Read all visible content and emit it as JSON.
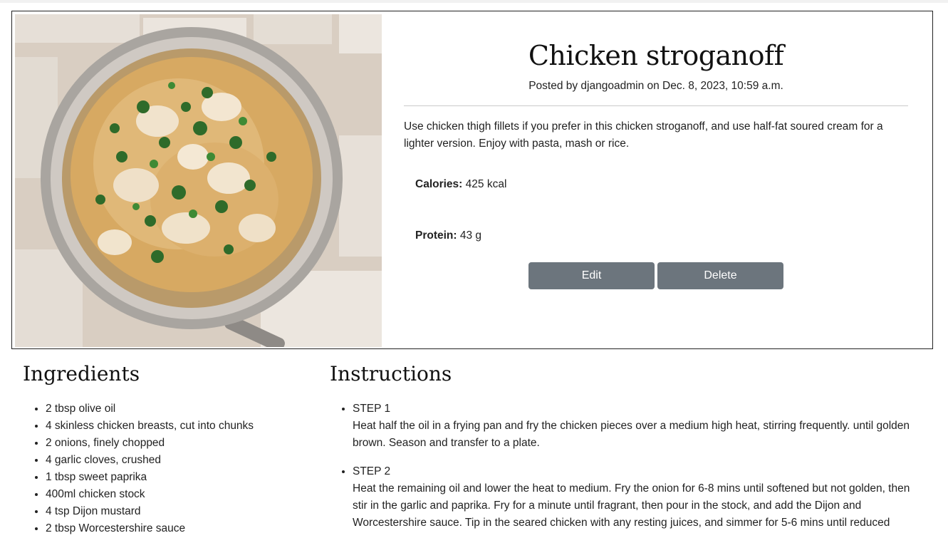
{
  "recipe": {
    "title": "Chicken stroganoff",
    "byline": "Posted by djangoadmin on Dec. 8, 2023, 10:59 a.m.",
    "description": "Use chicken thigh fillets if you prefer in this chicken stroganoff, and use half-fat soured cream for a lighter version. Enjoy with pasta, mash or rice.",
    "calories_label": "Calories:",
    "calories_value": "425 kcal",
    "protein_label": "Protein:",
    "protein_value": "43 g",
    "edit_label": "Edit",
    "delete_label": "Delete"
  },
  "ingredients": {
    "heading": "Ingredients",
    "items": [
      "2 tbsp olive oil",
      "4 skinless chicken breasts, cut into chunks",
      "2 onions, finely chopped",
      "4 garlic cloves, crushed",
      "1 tbsp sweet paprika",
      "400ml chicken stock",
      "4 tsp Dijon mustard",
      "2 tbsp Worcestershire sauce"
    ]
  },
  "instructions": {
    "heading": "Instructions",
    "steps": [
      {
        "title": "STEP 1",
        "text": "Heat half the oil in a frying pan and fry the chicken pieces over a medium high heat, stirring frequently. until golden brown. Season and transfer to a plate."
      },
      {
        "title": "STEP 2",
        "text": "Heat the remaining oil and lower the heat to medium. Fry the onion for 6-8 mins until softened but not golden, then stir in the garlic and paprika. Fry for a minute until fragrant, then pour in the stock, and add the Dijon and Worcestershire sauce. Tip in the seared chicken with any resting juices, and simmer for 5-6 mins until reduced"
      }
    ]
  },
  "colors": {
    "button_bg": "#6c757d",
    "button_text": "#ffffff",
    "card_border": "#222222"
  }
}
